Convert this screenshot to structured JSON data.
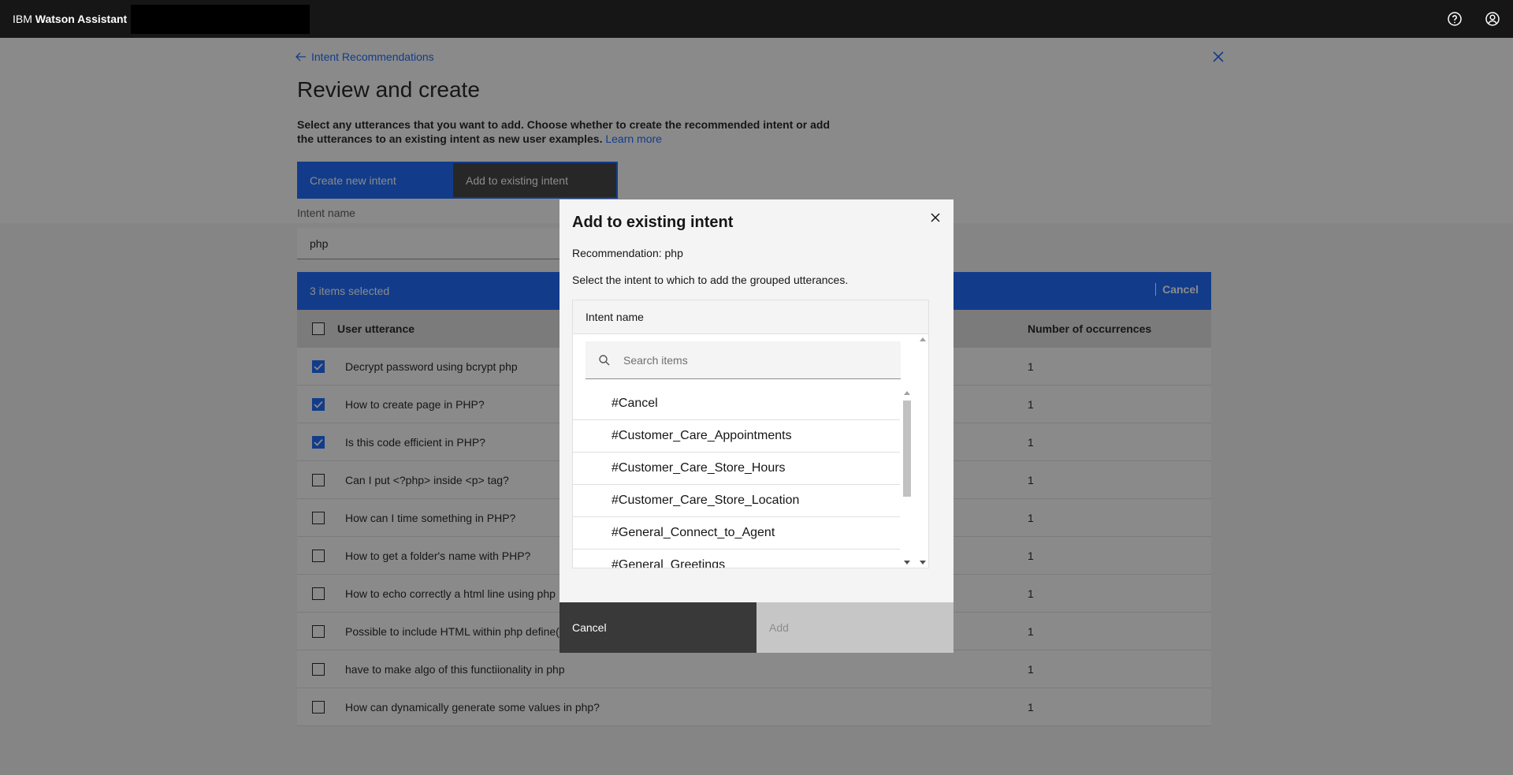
{
  "header": {
    "brand_prefix": "IBM",
    "brand_name": "Watson Assistant",
    "icons": [
      "help-icon",
      "user-avatar-icon"
    ]
  },
  "page": {
    "back_link": "Intent Recommendations",
    "title": "Review and create",
    "description": "Select any utterances that you want to add. Choose whether to create the recommended intent or add the utterances to an existing intent as new user examples.",
    "learn_more": "Learn more",
    "toggle": {
      "create_new": "Create new intent",
      "add_existing": "Add to existing intent"
    },
    "intent_name_label": "Intent name",
    "intent_name_value": "php"
  },
  "selection_bar": {
    "count_text": "3 items selected",
    "cancel": "Cancel"
  },
  "table": {
    "headers": {
      "utterance": "User utterance",
      "occurrences": "Number of occurrences"
    },
    "rows": [
      {
        "checked": true,
        "utterance": "Decrypt password using bcrypt php",
        "occurrences": "1"
      },
      {
        "checked": true,
        "utterance": "How to create page in PHP?",
        "occurrences": "1"
      },
      {
        "checked": true,
        "utterance": "Is this code efficient in PHP?",
        "occurrences": "1"
      },
      {
        "checked": false,
        "utterance": "Can I put <?php> inside <p> tag?",
        "occurrences": "1"
      },
      {
        "checked": false,
        "utterance": "How can I time something in PHP?",
        "occurrences": "1"
      },
      {
        "checked": false,
        "utterance": "How to get a folder's name with PHP?",
        "occurrences": "1"
      },
      {
        "checked": false,
        "utterance": "How to echo correctly a html line using php",
        "occurrences": "1"
      },
      {
        "checked": false,
        "utterance": "Possible to include HTML within php define()?",
        "occurrences": "1"
      },
      {
        "checked": false,
        "utterance": "have to make algo of this functiionality in php",
        "occurrences": "1"
      },
      {
        "checked": false,
        "utterance": "How can dynamically generate some values in php?",
        "occurrences": "1"
      }
    ]
  },
  "modal": {
    "title": "Add to existing intent",
    "recommendation": "Recommendation: php",
    "instruction": "Select the intent to which to add the grouped utterances.",
    "list_header": "Intent name",
    "search_placeholder": "Search items",
    "intents": [
      "#Cancel",
      "#Customer_Care_Appointments",
      "#Customer_Care_Store_Hours",
      "#Customer_Care_Store_Location",
      "#General_Connect_to_Agent",
      "#General_Greetings"
    ],
    "cancel_button": "Cancel",
    "add_button": "Add"
  }
}
